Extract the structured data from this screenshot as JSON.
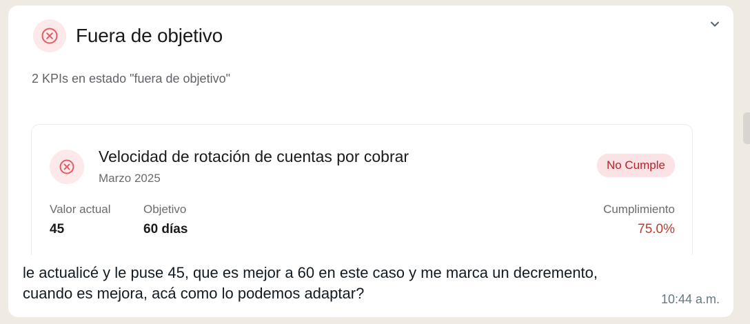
{
  "section": {
    "title": "Fuera de objetivo",
    "subtitle": "2 KPIs en estado \"fuera de objetivo\"",
    "icon": "x-circle-icon",
    "accent_color": "#e35b63"
  },
  "kpi": {
    "title": "Velocidad de rotación de cuentas por cobrar",
    "period": "Marzo 2025",
    "badge": "No Cumple",
    "badge_color": "#b4232c",
    "metrics": [
      {
        "label": "Valor actual",
        "value": "45"
      },
      {
        "label": "Objetivo",
        "value": "60 días"
      },
      {
        "label": "Cumplimiento",
        "value": "75.0%"
      }
    ]
  },
  "message": {
    "text": "le actualicé y le puse 45, que es mejor a 60 en este caso y me marca un decremento, cuando es mejora, acá como lo podemos adaptar?",
    "time": "10:44 a.m."
  }
}
